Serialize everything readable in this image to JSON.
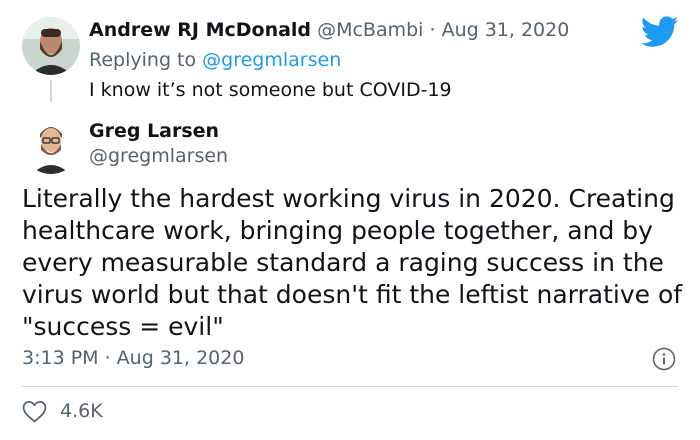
{
  "reply_tweet": {
    "author_name": "Andrew RJ McDonald",
    "author_handle": "@McBambi",
    "separator": " · ",
    "date": "Aug 31, 2020",
    "replying_prefix": "Replying to ",
    "replying_to": "@gregmlarsen",
    "text": "I know it’s not someone but COVID-19"
  },
  "main_tweet": {
    "author_name": "Greg Larsen",
    "author_handle": "@gregmlarsen",
    "text_lines": [
      "Literally the hardest working virus in 2020. Creating",
      "healthcare work, bringing people together, and by",
      "every measurable standard a raging success in the",
      "virus world but that doesn't fit the leftist narrative of",
      "\"success = evil\""
    ],
    "timestamp": "3:13 PM · Aug 31, 2020",
    "likes": "4.6K"
  },
  "icons": {
    "brand": "twitter-bird-icon",
    "info": "info-icon",
    "like": "heart-icon"
  },
  "colors": {
    "accent": "#1d9bf0",
    "text_primary": "#0f1419",
    "text_secondary": "#536471",
    "divider": "#cfd9de"
  }
}
